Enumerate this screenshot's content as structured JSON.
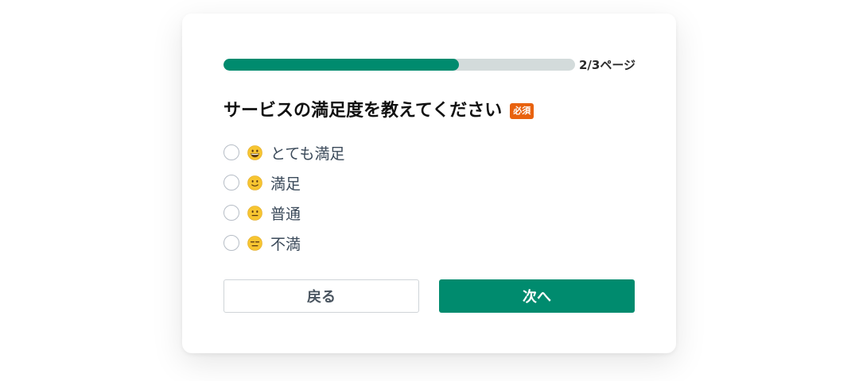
{
  "progress": {
    "fraction": 0.67,
    "label": "2/3ページ"
  },
  "question": {
    "title": "サービスの満足度を教えてください",
    "required_badge": "必須"
  },
  "options": [
    {
      "label": "とても満足",
      "icon": "grinning-face-icon"
    },
    {
      "label": "満足",
      "icon": "slightly-smiling-face-icon"
    },
    {
      "label": "普通",
      "icon": "neutral-face-icon"
    },
    {
      "label": "不満",
      "icon": "expressionless-face-icon"
    }
  ],
  "buttons": {
    "back_label": "戻る",
    "next_label": "次へ"
  },
  "colors": {
    "accent": "#008b6e",
    "required": "#e8620f",
    "progress_track": "#d3dbdb"
  }
}
